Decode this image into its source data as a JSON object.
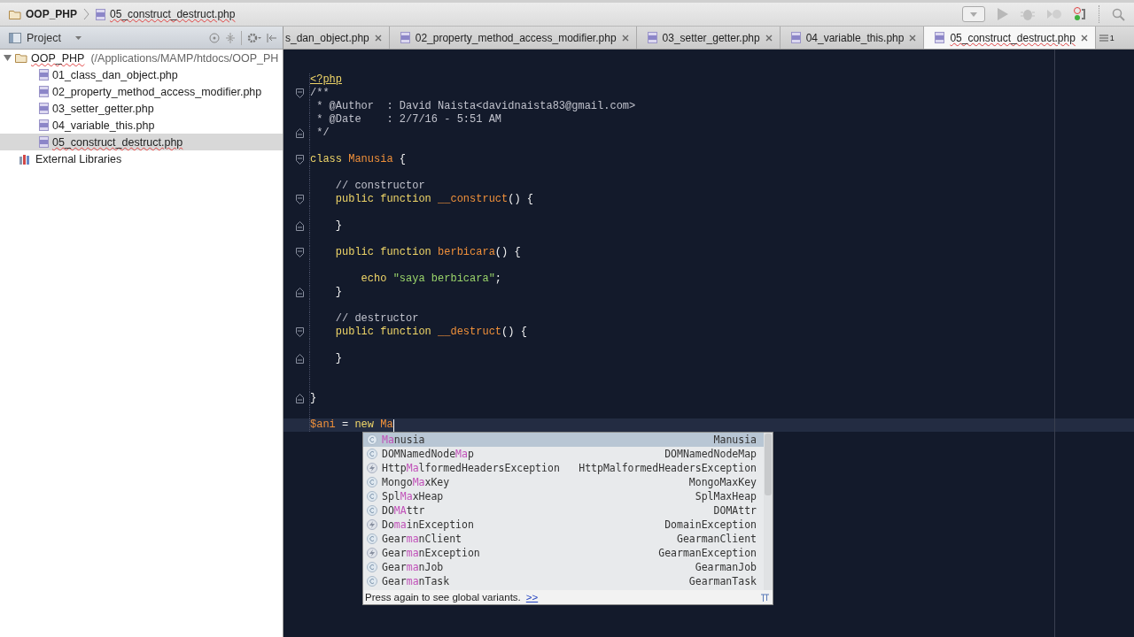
{
  "breadcrumb": [
    {
      "kind": "folder",
      "label": "OOP_PHP"
    },
    {
      "kind": "file",
      "label": "05_construct_destruct.php"
    }
  ],
  "project_panel": {
    "title": "Project"
  },
  "tree": {
    "label": "OOP_PHP",
    "path": "(/Applications/MAMP/htdocs/OOP_PH",
    "expanded": true,
    "children": [
      {
        "label": "01_class_dan_object.php",
        "selected": false
      },
      {
        "label": "02_property_method_access_modifier.php",
        "selected": false
      },
      {
        "label": "03_setter_getter.php",
        "selected": false
      },
      {
        "label": "04_variable_this.php",
        "selected": false
      },
      {
        "label": "05_construct_destruct.php",
        "selected": true
      }
    ]
  },
  "external_libraries": {
    "label": "External Libraries"
  },
  "tabs": [
    {
      "kind": "partial",
      "label": "s_dan_object.php",
      "selected": false
    },
    {
      "kind": "file",
      "label": "02_property_method_access_modifier.php",
      "selected": false
    },
    {
      "kind": "file",
      "label": "03_setter_getter.php",
      "selected": false
    },
    {
      "kind": "file",
      "label": "04_variable_this.php",
      "selected": false
    },
    {
      "kind": "file",
      "label": "05_construct_destruct.php",
      "selected": true
    }
  ],
  "hidden_tabs": "1",
  "code": [
    {
      "current": false,
      "tokens": [
        {
          "kind": "tag",
          "text": "<?php"
        }
      ]
    },
    {
      "current": false,
      "fold_start": true,
      "tokens": [
        {
          "kind": "comment",
          "text": "/**"
        }
      ]
    },
    {
      "current": false,
      "tokens": [
        {
          "kind": "comment",
          "text": " * @Author  : David Naista<davidnaista83@gmail.com>"
        }
      ]
    },
    {
      "current": false,
      "tokens": [
        {
          "kind": "comment",
          "text": " * @Date    : 2/7/16 - 5:51 AM"
        }
      ]
    },
    {
      "current": false,
      "fold_end": true,
      "tokens": [
        {
          "kind": "comment",
          "text": " */"
        }
      ]
    },
    {
      "current": false
    },
    {
      "current": false,
      "fold_start": true,
      "tokens": [
        {
          "kind": "keyword",
          "text": "class "
        },
        {
          "kind": "type",
          "text": "Manusia"
        },
        {
          "kind": "plain",
          "text": " {"
        }
      ]
    },
    {
      "current": false
    },
    {
      "current": false,
      "tokens": [
        {
          "kind": "comment",
          "text": "    // constructor"
        }
      ]
    },
    {
      "current": false,
      "fold_start": true,
      "tokens": [
        {
          "kind": "keyword",
          "text": "    public function "
        },
        {
          "kind": "function",
          "text": "__construct"
        },
        {
          "kind": "plain",
          "text": "() {"
        }
      ]
    },
    {
      "current": false
    },
    {
      "current": false,
      "fold_end": true,
      "tokens": [
        {
          "kind": "plain",
          "text": "    }"
        }
      ]
    },
    {
      "current": false
    },
    {
      "current": false,
      "fold_start": true,
      "tokens": [
        {
          "kind": "keyword",
          "text": "    public function "
        },
        {
          "kind": "function",
          "text": "berbicara"
        },
        {
          "kind": "plain",
          "text": "() {"
        }
      ]
    },
    {
      "current": false
    },
    {
      "current": false,
      "tokens": [
        {
          "kind": "keyword",
          "text": "        echo "
        },
        {
          "kind": "string",
          "text": "\"saya berbicara\""
        },
        {
          "kind": "plain",
          "text": ";"
        }
      ]
    },
    {
      "current": false,
      "fold_end": true,
      "tokens": [
        {
          "kind": "plain",
          "text": "    }"
        }
      ]
    },
    {
      "current": false
    },
    {
      "current": false,
      "tokens": [
        {
          "kind": "comment",
          "text": "    // destructor"
        }
      ]
    },
    {
      "current": false,
      "fold_start": true,
      "tokens": [
        {
          "kind": "keyword",
          "text": "    public function "
        },
        {
          "kind": "function",
          "text": "__destruct"
        },
        {
          "kind": "plain",
          "text": "() {"
        }
      ]
    },
    {
      "current": false
    },
    {
      "current": false,
      "fold_end": true,
      "tokens": [
        {
          "kind": "plain",
          "text": "    }"
        }
      ]
    },
    {
      "current": false
    },
    {
      "current": false
    },
    {
      "current": false,
      "fold_end": true,
      "tokens": [
        {
          "kind": "plain",
          "text": "}"
        }
      ]
    },
    {
      "current": false
    },
    {
      "current": true,
      "tokens": [
        {
          "kind": "variable",
          "text": "$ani"
        },
        {
          "kind": "plain",
          "text": " = "
        },
        {
          "kind": "keyword",
          "text": "new "
        },
        {
          "kind": "type",
          "text": "Ma"
        }
      ]
    }
  ],
  "completion": {
    "items": [
      {
        "kind": "class",
        "selected": true,
        "match": "Ma",
        "after": "nusia",
        "type": "Manusia"
      },
      {
        "kind": "class",
        "selected": false,
        "before": "DOMNamedNode",
        "match": "Ma",
        "after": "p",
        "type": "DOMNamedNodeMap"
      },
      {
        "kind": "exception",
        "selected": false,
        "before": "Http",
        "match": "Ma",
        "after": "lformedHeadersException",
        "type": "HttpMalformedHeadersException"
      },
      {
        "kind": "class",
        "selected": false,
        "before": "Mongo",
        "match": "Ma",
        "after": "xKey",
        "type": "MongoMaxKey"
      },
      {
        "kind": "class",
        "selected": false,
        "before": "Spl",
        "match": "Ma",
        "after": "xHeap",
        "type": "SplMaxHeap"
      },
      {
        "kind": "class",
        "selected": false,
        "before": "DO",
        "match": "MA",
        "after": "ttr",
        "type": "DOMAttr"
      },
      {
        "kind": "exception",
        "selected": false,
        "before": "Do",
        "match": "ma",
        "after": "inException",
        "type": "DomainException"
      },
      {
        "kind": "class",
        "selected": false,
        "before": "Gear",
        "match": "ma",
        "after": "nClient",
        "type": "GearmanClient"
      },
      {
        "kind": "exception",
        "selected": false,
        "before": "Gear",
        "match": "ma",
        "after": "nException",
        "type": "GearmanException"
      },
      {
        "kind": "class",
        "selected": false,
        "before": "Gear",
        "match": "ma",
        "after": "nJob",
        "type": "GearmanJob"
      },
      {
        "kind": "class",
        "selected": false,
        "before": "Gear",
        "match": "ma",
        "after": "nTask",
        "type": "GearmanTask"
      }
    ],
    "hint": "Press again to see global variants.",
    "hint_link": ">>"
  }
}
